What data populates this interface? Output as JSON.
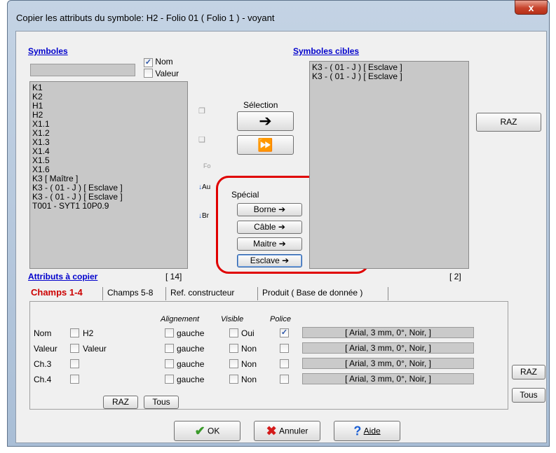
{
  "window": {
    "title": "Copier les attributs du symbole: H2 - Folio 01 ( Folio 1 ) - voyant",
    "close_label": "x"
  },
  "symbols": {
    "heading": "Symboles",
    "nom_label": "Nom",
    "valeur_label": "Valeur",
    "items": [
      "K1",
      "K2",
      "H1",
      "H2",
      "X1.1",
      "X1.2",
      "X1.3",
      "X1.4",
      "X1.5",
      "X1.6",
      "K3 [ Maître ]",
      "K3 - ( 01 - J ) [ Esclave ]",
      "K3 - ( 01 - J ) [ Esclave ]",
      "T001 - SYT1 10P0.9"
    ],
    "count": "[ 14]"
  },
  "targets": {
    "heading": "Symboles cibles",
    "items": [
      "K3 - ( 01 - J ) [ Esclave ]",
      "K3 - ( 01 - J ) [ Esclave ]"
    ],
    "count": "[ 2]"
  },
  "side_icons": {
    "fo": "Fo",
    "au": "Au",
    "br": "Br"
  },
  "selection": {
    "label": "Sélection",
    "arrow": "➔",
    "double_arrow": "⏩"
  },
  "special": {
    "label": "Spécial",
    "buttons": [
      "Borne ➔",
      "Câble ➔",
      "Maitre ➔",
      "Esclave ➔"
    ]
  },
  "raz_top": "RAZ",
  "attributes": {
    "heading": "Attributs à copier",
    "tabs": [
      "Champs 1-4",
      "Champs 5-8",
      "Ref. constructeur",
      "Produit ( Base de donnée )"
    ],
    "col_alignement": "Alignement",
    "col_visible": "Visible",
    "col_police": "Police",
    "rows": [
      {
        "name": "Nom",
        "value": "H2",
        "align": "gauche",
        "visible": "Oui",
        "police_checked": true,
        "font": "[ Arial, 3 mm, 0°, Noir,  ]"
      },
      {
        "name": "Valeur",
        "value": "Valeur",
        "align": "gauche",
        "visible": "Non",
        "police_checked": false,
        "font": "[ Arial, 3 mm, 0°, Noir,  ]"
      },
      {
        "name": "Ch.3",
        "value": "",
        "align": "gauche",
        "visible": "Non",
        "police_checked": false,
        "font": "[ Arial, 3 mm, 0°, Noir,  ]"
      },
      {
        "name": "Ch.4",
        "value": "",
        "align": "gauche",
        "visible": "Non",
        "police_checked": false,
        "font": "[ Arial, 3 mm, 0°, Noir,  ]"
      }
    ],
    "raz_label": "RAZ",
    "tous_label": "Tous"
  },
  "side_raz": "RAZ",
  "side_tous": "Tous",
  "footer": {
    "ok": "OK",
    "cancel": "Annuler",
    "help": "Aide"
  },
  "colors": {
    "active_tab": "#cc0000",
    "highlight": "#e00000",
    "link": "#0000cc"
  }
}
